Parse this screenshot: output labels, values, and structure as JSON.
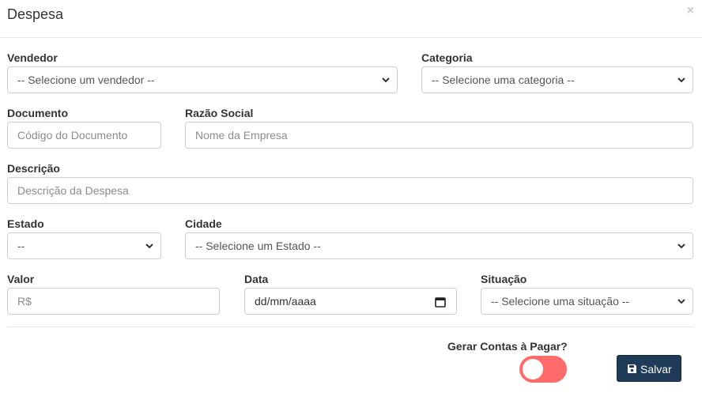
{
  "modal": {
    "title": "Despesa",
    "close": "×"
  },
  "form": {
    "vendedor": {
      "label": "Vendedor",
      "value": "-- Selecione um vendedor --"
    },
    "categoria": {
      "label": "Categoria",
      "value": "-- Selecione uma categoria --"
    },
    "documento": {
      "label": "Documento",
      "placeholder": "Código do Documento"
    },
    "razao_social": {
      "label": "Razão Social",
      "placeholder": "Nome da Empresa"
    },
    "descricao": {
      "label": "Descrição",
      "placeholder": "Descrição da Despesa"
    },
    "estado": {
      "label": "Estado",
      "value": "--"
    },
    "cidade": {
      "label": "Cidade",
      "value": "-- Selecione um Estado --"
    },
    "valor": {
      "label": "Valor",
      "placeholder": "R$"
    },
    "data": {
      "label": "Data",
      "value": "dd/mm/aaaa"
    },
    "situacao": {
      "label": "Situação",
      "value": "-- Selecione uma situação --"
    },
    "gerar_contas": {
      "label": "Gerar Contas à Pagar?",
      "checked": false,
      "color": "#ff6b6b"
    }
  },
  "footer": {
    "save_label": "Salvar",
    "save_color": "#1f3b57"
  }
}
